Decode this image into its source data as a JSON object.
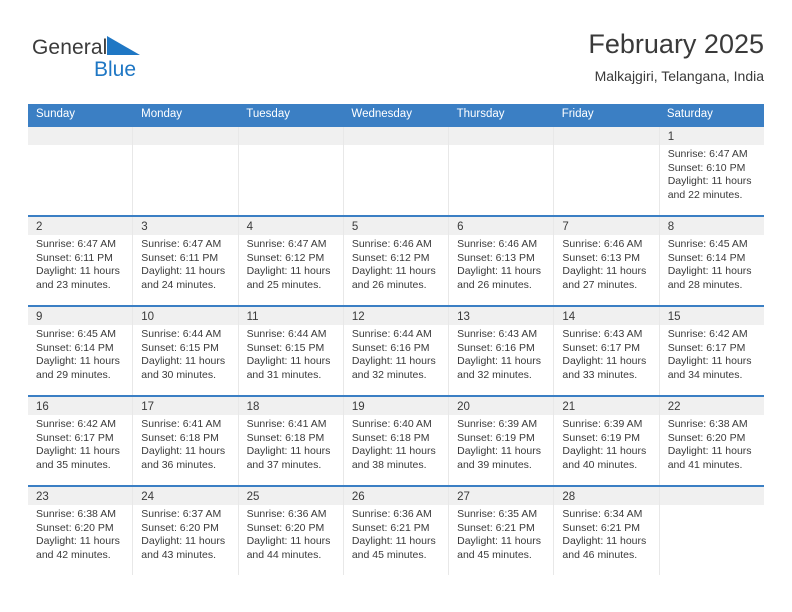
{
  "brand": {
    "name_part1": "General",
    "name_part2": "Blue",
    "triangle_color": "#1f77c4"
  },
  "header": {
    "title": "February 2025",
    "subtitle": "Malkajgiri, Telangana, India"
  },
  "theme": {
    "header_blue": "#3b7fc4",
    "daynum_band": "#f0f0f0",
    "text": "#3a3a3a"
  },
  "weekday_headers": [
    "Sunday",
    "Monday",
    "Tuesday",
    "Wednesday",
    "Thursday",
    "Friday",
    "Saturday"
  ],
  "weeks": [
    [
      {
        "day": "",
        "sunrise": "",
        "sunset": "",
        "daylight1": "",
        "daylight2": ""
      },
      {
        "day": "",
        "sunrise": "",
        "sunset": "",
        "daylight1": "",
        "daylight2": ""
      },
      {
        "day": "",
        "sunrise": "",
        "sunset": "",
        "daylight1": "",
        "daylight2": ""
      },
      {
        "day": "",
        "sunrise": "",
        "sunset": "",
        "daylight1": "",
        "daylight2": ""
      },
      {
        "day": "",
        "sunrise": "",
        "sunset": "",
        "daylight1": "",
        "daylight2": ""
      },
      {
        "day": "",
        "sunrise": "",
        "sunset": "",
        "daylight1": "",
        "daylight2": ""
      },
      {
        "day": "1",
        "sunrise": "Sunrise: 6:47 AM",
        "sunset": "Sunset: 6:10 PM",
        "daylight1": "Daylight: 11 hours",
        "daylight2": "and 22 minutes."
      }
    ],
    [
      {
        "day": "2",
        "sunrise": "Sunrise: 6:47 AM",
        "sunset": "Sunset: 6:11 PM",
        "daylight1": "Daylight: 11 hours",
        "daylight2": "and 23 minutes."
      },
      {
        "day": "3",
        "sunrise": "Sunrise: 6:47 AM",
        "sunset": "Sunset: 6:11 PM",
        "daylight1": "Daylight: 11 hours",
        "daylight2": "and 24 minutes."
      },
      {
        "day": "4",
        "sunrise": "Sunrise: 6:47 AM",
        "sunset": "Sunset: 6:12 PM",
        "daylight1": "Daylight: 11 hours",
        "daylight2": "and 25 minutes."
      },
      {
        "day": "5",
        "sunrise": "Sunrise: 6:46 AM",
        "sunset": "Sunset: 6:12 PM",
        "daylight1": "Daylight: 11 hours",
        "daylight2": "and 26 minutes."
      },
      {
        "day": "6",
        "sunrise": "Sunrise: 6:46 AM",
        "sunset": "Sunset: 6:13 PM",
        "daylight1": "Daylight: 11 hours",
        "daylight2": "and 26 minutes."
      },
      {
        "day": "7",
        "sunrise": "Sunrise: 6:46 AM",
        "sunset": "Sunset: 6:13 PM",
        "daylight1": "Daylight: 11 hours",
        "daylight2": "and 27 minutes."
      },
      {
        "day": "8",
        "sunrise": "Sunrise: 6:45 AM",
        "sunset": "Sunset: 6:14 PM",
        "daylight1": "Daylight: 11 hours",
        "daylight2": "and 28 minutes."
      }
    ],
    [
      {
        "day": "9",
        "sunrise": "Sunrise: 6:45 AM",
        "sunset": "Sunset: 6:14 PM",
        "daylight1": "Daylight: 11 hours",
        "daylight2": "and 29 minutes."
      },
      {
        "day": "10",
        "sunrise": "Sunrise: 6:44 AM",
        "sunset": "Sunset: 6:15 PM",
        "daylight1": "Daylight: 11 hours",
        "daylight2": "and 30 minutes."
      },
      {
        "day": "11",
        "sunrise": "Sunrise: 6:44 AM",
        "sunset": "Sunset: 6:15 PM",
        "daylight1": "Daylight: 11 hours",
        "daylight2": "and 31 minutes."
      },
      {
        "day": "12",
        "sunrise": "Sunrise: 6:44 AM",
        "sunset": "Sunset: 6:16 PM",
        "daylight1": "Daylight: 11 hours",
        "daylight2": "and 32 minutes."
      },
      {
        "day": "13",
        "sunrise": "Sunrise: 6:43 AM",
        "sunset": "Sunset: 6:16 PM",
        "daylight1": "Daylight: 11 hours",
        "daylight2": "and 32 minutes."
      },
      {
        "day": "14",
        "sunrise": "Sunrise: 6:43 AM",
        "sunset": "Sunset: 6:17 PM",
        "daylight1": "Daylight: 11 hours",
        "daylight2": "and 33 minutes."
      },
      {
        "day": "15",
        "sunrise": "Sunrise: 6:42 AM",
        "sunset": "Sunset: 6:17 PM",
        "daylight1": "Daylight: 11 hours",
        "daylight2": "and 34 minutes."
      }
    ],
    [
      {
        "day": "16",
        "sunrise": "Sunrise: 6:42 AM",
        "sunset": "Sunset: 6:17 PM",
        "daylight1": "Daylight: 11 hours",
        "daylight2": "and 35 minutes."
      },
      {
        "day": "17",
        "sunrise": "Sunrise: 6:41 AM",
        "sunset": "Sunset: 6:18 PM",
        "daylight1": "Daylight: 11 hours",
        "daylight2": "and 36 minutes."
      },
      {
        "day": "18",
        "sunrise": "Sunrise: 6:41 AM",
        "sunset": "Sunset: 6:18 PM",
        "daylight1": "Daylight: 11 hours",
        "daylight2": "and 37 minutes."
      },
      {
        "day": "19",
        "sunrise": "Sunrise: 6:40 AM",
        "sunset": "Sunset: 6:18 PM",
        "daylight1": "Daylight: 11 hours",
        "daylight2": "and 38 minutes."
      },
      {
        "day": "20",
        "sunrise": "Sunrise: 6:39 AM",
        "sunset": "Sunset: 6:19 PM",
        "daylight1": "Daylight: 11 hours",
        "daylight2": "and 39 minutes."
      },
      {
        "day": "21",
        "sunrise": "Sunrise: 6:39 AM",
        "sunset": "Sunset: 6:19 PM",
        "daylight1": "Daylight: 11 hours",
        "daylight2": "and 40 minutes."
      },
      {
        "day": "22",
        "sunrise": "Sunrise: 6:38 AM",
        "sunset": "Sunset: 6:20 PM",
        "daylight1": "Daylight: 11 hours",
        "daylight2": "and 41 minutes."
      }
    ],
    [
      {
        "day": "23",
        "sunrise": "Sunrise: 6:38 AM",
        "sunset": "Sunset: 6:20 PM",
        "daylight1": "Daylight: 11 hours",
        "daylight2": "and 42 minutes."
      },
      {
        "day": "24",
        "sunrise": "Sunrise: 6:37 AM",
        "sunset": "Sunset: 6:20 PM",
        "daylight1": "Daylight: 11 hours",
        "daylight2": "and 43 minutes."
      },
      {
        "day": "25",
        "sunrise": "Sunrise: 6:36 AM",
        "sunset": "Sunset: 6:20 PM",
        "daylight1": "Daylight: 11 hours",
        "daylight2": "and 44 minutes."
      },
      {
        "day": "26",
        "sunrise": "Sunrise: 6:36 AM",
        "sunset": "Sunset: 6:21 PM",
        "daylight1": "Daylight: 11 hours",
        "daylight2": "and 45 minutes."
      },
      {
        "day": "27",
        "sunrise": "Sunrise: 6:35 AM",
        "sunset": "Sunset: 6:21 PM",
        "daylight1": "Daylight: 11 hours",
        "daylight2": "and 45 minutes."
      },
      {
        "day": "28",
        "sunrise": "Sunrise: 6:34 AM",
        "sunset": "Sunset: 6:21 PM",
        "daylight1": "Daylight: 11 hours",
        "daylight2": "and 46 minutes."
      },
      {
        "day": "",
        "sunrise": "",
        "sunset": "",
        "daylight1": "",
        "daylight2": ""
      }
    ]
  ]
}
